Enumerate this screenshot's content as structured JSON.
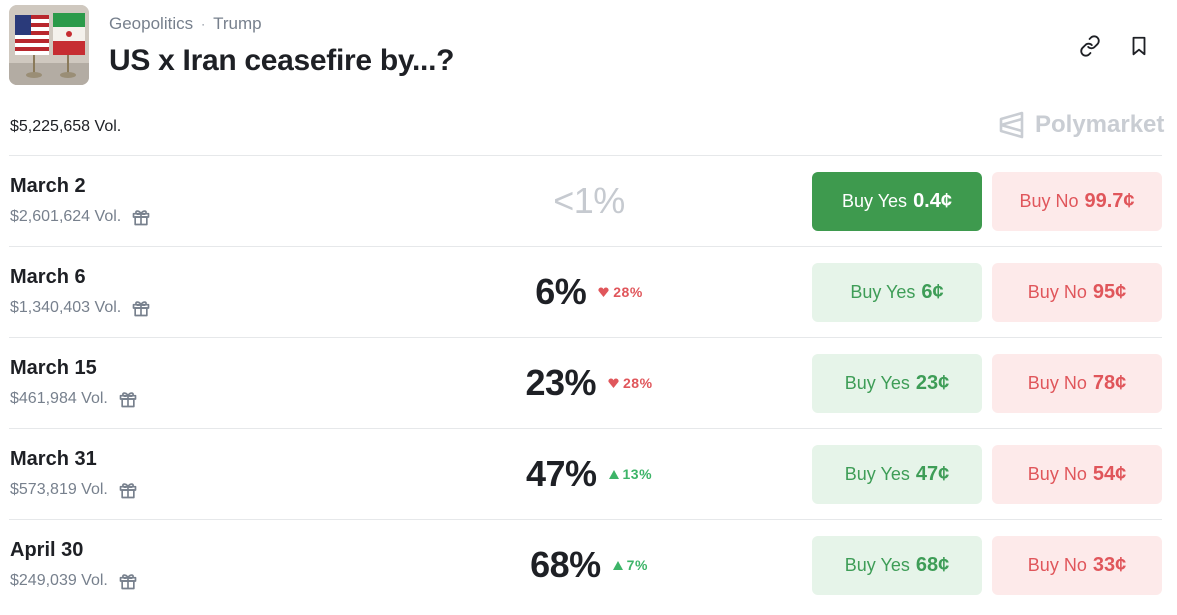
{
  "header": {
    "breadcrumb": [
      "Geopolitics",
      "Trump"
    ],
    "breadcrumb_separator": "·",
    "title": "US x Iran ceasefire by...?",
    "total_volume": "$5,225,658 Vol.",
    "brand": "Polymarket",
    "icons": [
      "link-icon",
      "bookmark-icon",
      "gift-icon",
      "polymarket-logo"
    ]
  },
  "colors": {
    "yes_active": "#3e9a4e",
    "yes_bg": "#e6f4e9",
    "yes_text": "#3e9d57",
    "no_bg": "#fdeaea",
    "no_text": "#e0565b",
    "up": "#3db468",
    "down": "#e0565b"
  },
  "markets": [
    {
      "date": "March 2",
      "volume": "$2,601,624 Vol.",
      "probability": "<1%",
      "change": "",
      "direction": "",
      "yes_label": "Buy Yes",
      "yes_price": "0.4¢",
      "no_label": "Buy No",
      "no_price": "99.7¢",
      "yes_active": true
    },
    {
      "date": "March 6",
      "volume": "$1,340,403 Vol.",
      "probability": "6%",
      "change": "28%",
      "direction": "down",
      "yes_label": "Buy Yes",
      "yes_price": "6¢",
      "no_label": "Buy No",
      "no_price": "95¢",
      "yes_active": false
    },
    {
      "date": "March 15",
      "volume": "$461,984 Vol.",
      "probability": "23%",
      "change": "28%",
      "direction": "down",
      "yes_label": "Buy Yes",
      "yes_price": "23¢",
      "no_label": "Buy No",
      "no_price": "78¢",
      "yes_active": false
    },
    {
      "date": "March 31",
      "volume": "$573,819 Vol.",
      "probability": "47%",
      "change": "13%",
      "direction": "up",
      "yes_label": "Buy Yes",
      "yes_price": "47¢",
      "no_label": "Buy No",
      "no_price": "54¢",
      "yes_active": false
    },
    {
      "date": "April 30",
      "volume": "$249,039 Vol.",
      "probability": "68%",
      "change": "7%",
      "direction": "up",
      "yes_label": "Buy Yes",
      "yes_price": "68¢",
      "no_label": "Buy No",
      "no_price": "33¢",
      "yes_active": false
    }
  ]
}
